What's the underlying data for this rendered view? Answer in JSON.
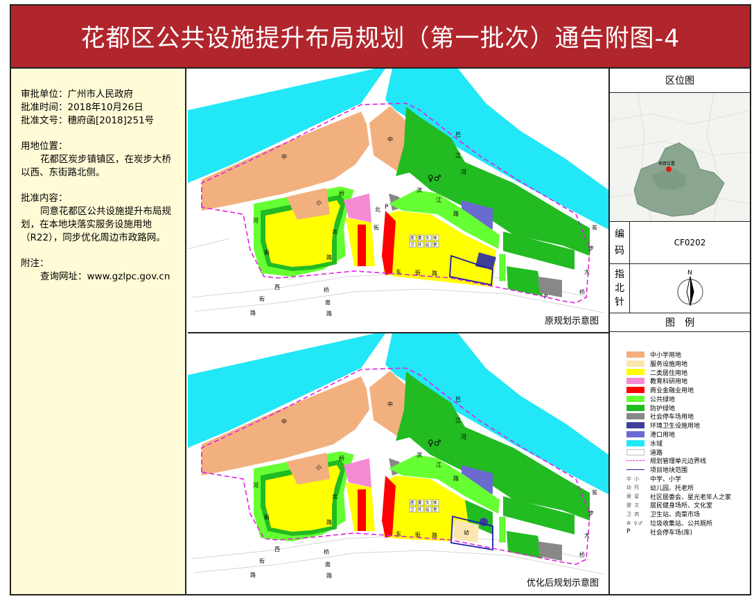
{
  "title": "花都区公共设施提升布局规划（第一批次）通告附图-4",
  "info": {
    "approval_unit": "审批单位：广州市人民政府",
    "approval_time": "批准时间：2018年10月26日",
    "approval_doc": "批准文号：穗府函[2018]251号",
    "location_label": "用地位置：",
    "location_text": "花都区炭步镇镇区，在炭步大桥以西、东街路北侧。",
    "content_label": "批准内容：",
    "content_text": "同意花都区公共设施提升布局规划，在本地块落实服务设施用地（R22），同步优化周边市政路网。",
    "note_label": "附注：",
    "note_text": "查询网址：www.gzlpc.gov.cn"
  },
  "maps": {
    "top_caption": "原规划示意图",
    "bottom_caption": "优化后规划示意图",
    "labels": {
      "zhong": "中",
      "xiao": "小",
      "you": "幼",
      "river": [
        "巴",
        "江",
        "河"
      ],
      "bin": [
        "滨",
        "江",
        "路"
      ],
      "bei": [
        "北",
        "街"
      ],
      "qiao_bei": [
        "桥",
        "北",
        "路"
      ],
      "dong": [
        "东",
        "街",
        "路"
      ],
      "xi": [
        "西",
        "街",
        "路"
      ],
      "qiao_nan": [
        "桥",
        "南",
        "路"
      ],
      "tan": [
        "炭",
        "步",
        "大",
        "桥"
      ],
      "river_west": [
        "河",
        "街"
      ],
      "parking": "P",
      "community": [
        "居",
        "委",
        "文",
        "体",
        "卫",
        "托",
        "站",
        "室"
      ]
    }
  },
  "right": {
    "location_head": "区位图",
    "project_label": "项目位置",
    "code_label": [
      "编",
      "码"
    ],
    "code_value": "CF0202",
    "north_label": [
      "指",
      "北",
      "针"
    ],
    "north_letter": "N",
    "legend_head": "图　例",
    "legend": [
      {
        "label": "中小学用地",
        "color": "#f2b07e",
        "kind": "fill"
      },
      {
        "label": "服务设施用地",
        "color": "#fbe6b0",
        "kind": "fill"
      },
      {
        "label": "二类居住用地",
        "color": "#ffff00",
        "kind": "fill"
      },
      {
        "label": "教育科研用地",
        "color": "#f58ad4",
        "kind": "fill"
      },
      {
        "label": "商业金融业用地",
        "color": "#ff0000",
        "kind": "fill"
      },
      {
        "label": "公共绿地",
        "color": "#66ff33",
        "kind": "fill"
      },
      {
        "label": "防护绿地",
        "color": "#22bb22",
        "kind": "fill"
      },
      {
        "label": "社会停车场用地",
        "color": "#888888",
        "kind": "fill"
      },
      {
        "label": "环境卫生设施用地",
        "color": "#3f3f9a",
        "kind": "fill"
      },
      {
        "label": "港口用地",
        "color": "#6a6ad0",
        "kind": "fill"
      },
      {
        "label": "水域",
        "color": "#22e7f7",
        "kind": "fill"
      },
      {
        "label": "道路",
        "color": "#ffffff",
        "kind": "fill"
      },
      {
        "label": "规划管理单元边界线",
        "color": "#e020e0",
        "kind": "dash"
      },
      {
        "label": "项目地块范围",
        "color": "#1a1aaa",
        "kind": "line"
      },
      {
        "label": "中学、小学",
        "kind": "icon"
      },
      {
        "label": "幼儿园、托老所",
        "kind": "icon"
      },
      {
        "label": "社区居委会、星光老年人之家",
        "kind": "icon"
      },
      {
        "label": "居民健身场所、文化室",
        "kind": "icon"
      },
      {
        "label": "卫生站、肉菜市场",
        "kind": "icon"
      },
      {
        "label": "垃圾收集站、公共厕所",
        "kind": "icon"
      },
      {
        "label": "社会停车场(库)",
        "kind": "p"
      }
    ]
  }
}
